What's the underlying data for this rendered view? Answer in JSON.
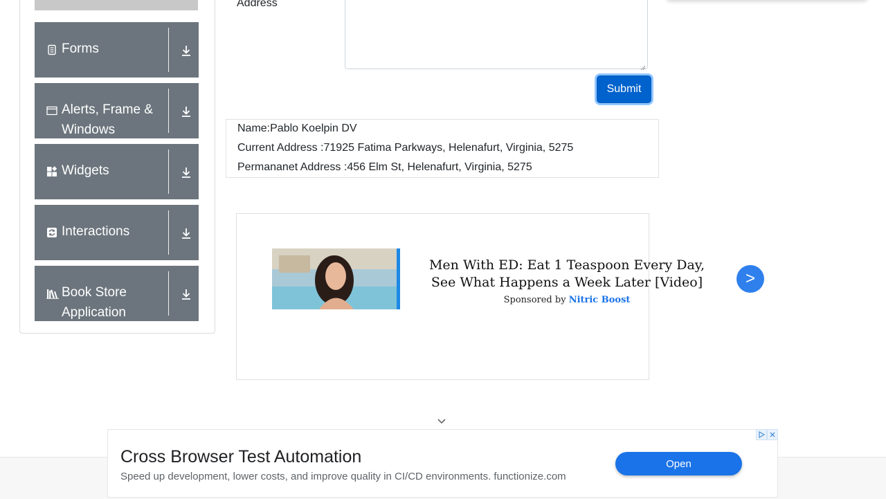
{
  "sidebar": {
    "groups": [
      {
        "label": "Forms",
        "icon": "document-icon"
      },
      {
        "label": "Alerts, Frame & Windows",
        "icon": "window-icon"
      },
      {
        "label": "Widgets",
        "icon": "widgets-icon"
      },
      {
        "label": "Interactions",
        "icon": "refresh-icon"
      },
      {
        "label": "Book Store Application",
        "icon": "books-icon"
      }
    ]
  },
  "form": {
    "address_label": "Address",
    "submit_label": "Submit"
  },
  "output": {
    "name": "Name:Pablo Koelpin DV",
    "current_address": "Current Address :71925 Fatima Parkways, Helenafurt, Virginia, 5275",
    "permanent_address": "Permananet Address :456 Elm St, Helenafurt, Virginia, 5275"
  },
  "ad": {
    "headline": "Men With ED: Eat 1 Teaspoon Every Day, See What Happens a Week Later [Video]",
    "sponsor_prefix": "Sponsored by",
    "sponsor_brand": "Nitric Boost",
    "next_label": ">"
  },
  "bottom_ad": {
    "title": "Cross Browser Test Automation",
    "description": "Speed up development, lower costs, and improve quality in CI/CD environments. functionize.com",
    "open_label": "Open"
  },
  "colors": {
    "sidebar_header": "#6c757d",
    "primary": "#0062cc",
    "ad_button": "#1a73e8"
  }
}
